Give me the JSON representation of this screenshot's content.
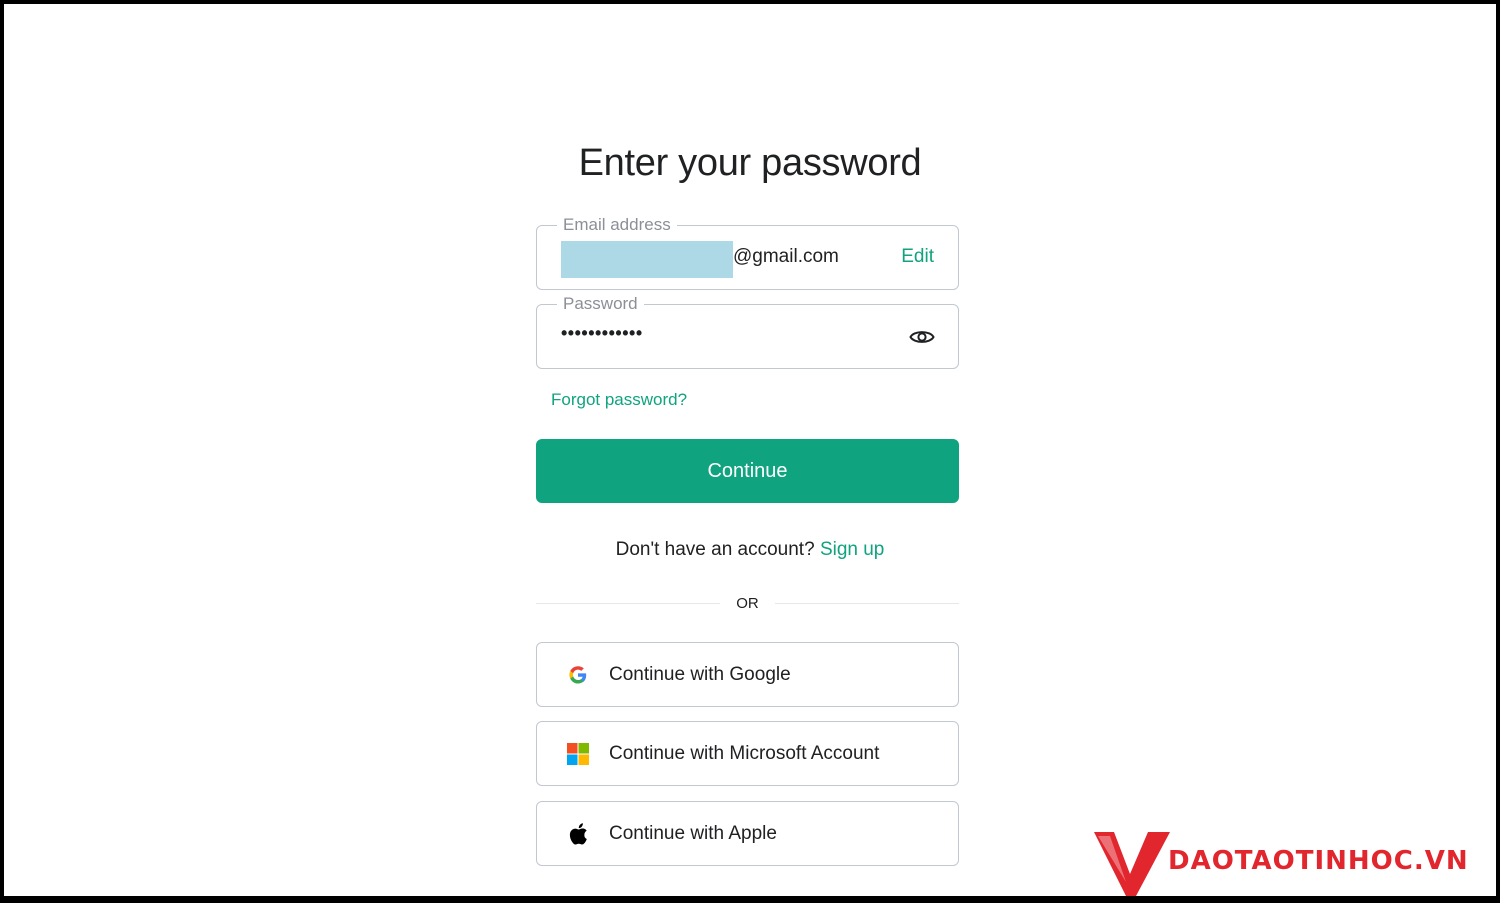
{
  "page": {
    "title": "Enter your password"
  },
  "email_field": {
    "label": "Email address",
    "value_suffix": "@gmail.com",
    "edit_label": "Edit"
  },
  "password_field": {
    "label": "Password",
    "value": "••••••••••••",
    "toggle_icon": "eye-icon"
  },
  "forgot_password": "Forgot password?",
  "continue_button": "Continue",
  "signup": {
    "prompt": "Don't have an account?",
    "link": "Sign up"
  },
  "divider": "OR",
  "social": [
    {
      "label": "Continue with Google",
      "icon": "google-icon"
    },
    {
      "label": "Continue with Microsoft Account",
      "icon": "microsoft-icon"
    },
    {
      "label": "Continue with Apple",
      "icon": "apple-icon"
    }
  ],
  "watermark": {
    "text": "DAOTAOTINHOC.VN"
  },
  "colors": {
    "accent": "#10a37f",
    "border": "#c2c8d0",
    "redaction": "#add8e6",
    "watermark": "#e1262d"
  }
}
